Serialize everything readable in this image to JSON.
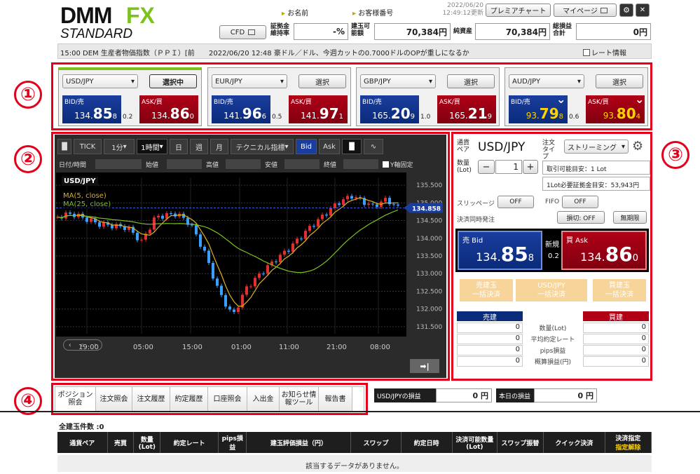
{
  "logo": {
    "brand": "DMM",
    "fx": "FX",
    "edition": "STANDARD"
  },
  "header": {
    "name_label": "お名前",
    "customer_label": "お客様番号",
    "date": "2022/06/20",
    "time": "12:49:12更新",
    "premium_chart": "プレミアチャート",
    "mypage": "マイページ",
    "cfd": "CFD",
    "margin_rate_label": "証拠金維持率",
    "margin_rate_value": "-%",
    "available_label": "建玉可能額",
    "available_value": "70,384円",
    "net_assets_label": "純資産",
    "net_assets_value": "70,384円",
    "total_pl_label": "総損益合計",
    "total_pl_value": "0円"
  },
  "ticker": {
    "left": "15:00 DEM 生産者物価指数（ＰＰＩ）[前",
    "news": "2022/06/20 12:48 豪ドル／ドル、今週カットの0.7000ドルのOPが重しになるか",
    "rate_info": "レート情報"
  },
  "annotations": [
    "①",
    "②",
    "③",
    "④"
  ],
  "pairs": [
    {
      "pair": "USD/JPY",
      "btn": "選択中",
      "bid_label": "BID/売",
      "bid_pre": "134.",
      "bid_big": "85",
      "bid_small": "8",
      "spread": "0.2",
      "ask_label": "ASK/買",
      "ask_pre": "134.",
      "ask_big": "86",
      "ask_small": "0"
    },
    {
      "pair": "EUR/JPY",
      "btn": "選択",
      "bid_label": "BID/売",
      "bid_pre": "141.",
      "bid_big": "96",
      "bid_small": "6",
      "spread": "0.5",
      "ask_label": "ASK/買",
      "ask_pre": "141.",
      "ask_big": "97",
      "ask_small": "1"
    },
    {
      "pair": "GBP/JPY",
      "btn": "選択",
      "bid_label": "BID/売",
      "bid_pre": "165.",
      "bid_big": "20",
      "bid_small": "9",
      "spread": "1.0",
      "ask_label": "ASK/買",
      "ask_pre": "165.",
      "ask_big": "21",
      "ask_small": "9"
    },
    {
      "pair": "AUD/JPY",
      "btn": "選択",
      "bid_label": "BID/売",
      "bid_pre": "93.",
      "bid_big": "79",
      "bid_small": "8",
      "spread": "0.6",
      "ask_label": "ASK/買",
      "ask_pre": "93.",
      "ask_big": "80",
      "ask_small": "4"
    }
  ],
  "chart_toolbar": {
    "tick": "TICK",
    "minute": "1分",
    "hour": "1時間",
    "day": "日",
    "week": "週",
    "month": "月",
    "tech": "テクニカル指標",
    "bid": "Bid",
    "ask": "Ask"
  },
  "ohlc": {
    "datetime": "日付/時間",
    "open": "始値",
    "high": "高値",
    "low": "安値",
    "close": "終値",
    "yfix": "Y軸固定"
  },
  "chart_data": {
    "type": "line",
    "title": "USD/JPY",
    "legend": [
      "MA(5, close)",
      "MA(25, close)"
    ],
    "y_ticks": [
      "135.500",
      "135.000",
      "134.500",
      "134.000",
      "133.500",
      "133.000",
      "132.500",
      "132.000",
      "131.500"
    ],
    "x_ticks": [
      "19:00",
      "05:00",
      "15:00",
      "01:00",
      "11:00",
      "21:00",
      "08:00"
    ],
    "last_price": "134.858"
  },
  "order": {
    "pair_label": "通貨ペア",
    "pair": "USD/JPY",
    "type_label": "注文タイプ",
    "type": "ストリーミング",
    "qty_label": "数量(Lot)",
    "qty": "1",
    "tradable": "取引可能目安：1 Lot",
    "margin_req": "1Lot必要証拠金目安：53,943円",
    "slippage": "スリッページ",
    "slip_val": "OFF",
    "fifo": "FIFO",
    "fifo_val": "OFF",
    "settle": "決済同時発注",
    "loss": "損切: OFF",
    "nolimit": "無期限",
    "bid_label": "売 Bid",
    "bid_pre": "134.",
    "bid_big": "85",
    "bid_small": "8",
    "new": "新規",
    "spread": "0.2",
    "ask_label": "買 Ask",
    "ask_pre": "134.",
    "ask_big": "86",
    "ask_small": "0",
    "sell_close": "売建玉",
    "sell_close2": "一括決済",
    "pair_close": "USD/JPY",
    "pair_close2": "一括決済",
    "buy_close": "買建玉",
    "buy_close2": "一括決済",
    "sell_header": "売建",
    "buy_header": "買建",
    "rows": [
      {
        "label": "数量(Lot)",
        "sell": "0",
        "buy": "0"
      },
      {
        "label": "平均約定レート",
        "sell": "0",
        "buy": "0"
      },
      {
        "label": "pips損益",
        "sell": "0",
        "buy": "0"
      },
      {
        "label": "概算損益(円)",
        "sell": "0",
        "buy": "0"
      }
    ]
  },
  "tabs": [
    "ポジション照会",
    "注文照会",
    "注文履歴",
    "約定履歴",
    "口座照会",
    "入出金",
    "お知らせ情報ツール",
    "報告書"
  ],
  "pl": {
    "pair_label": "USD/JPYの損益",
    "pair_value": "0 円",
    "today_label": "本日の損益",
    "today_value": "0 円"
  },
  "positions": {
    "count": "全建玉件数 :0",
    "headers": [
      "通貨ペア",
      "売買",
      "数量(Lot)",
      "約定レート",
      "pips損益",
      "建玉評価損益（円）",
      "スワップ",
      "約定日時",
      "決済可能数量(Lot)",
      "スワップ振替",
      "クイック決済",
      "決済指定"
    ],
    "header_sub": "指定解除",
    "empty": "該当するデータがありません。"
  }
}
